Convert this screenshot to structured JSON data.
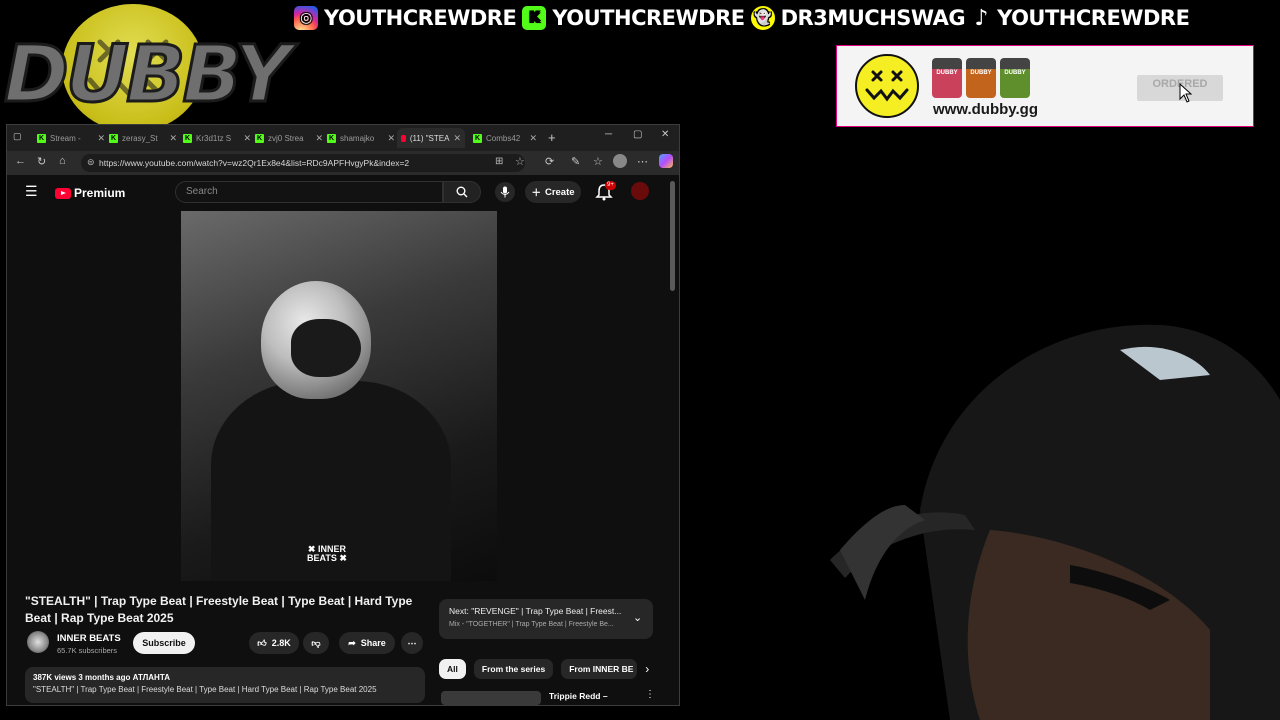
{
  "overlay": {
    "socials": [
      {
        "icon": "instagram-icon",
        "handle": "YOUTHCREWDRE"
      },
      {
        "icon": "kick-icon",
        "handle": "YOUTHCREWDRE"
      },
      {
        "icon": "snapchat-icon",
        "handle": "DR3MUCHSWAG"
      },
      {
        "icon": "tiktok-icon",
        "handle": "YOUTHCREWDRE"
      }
    ],
    "logo_text": "DUBBY",
    "ad": {
      "url": "www.dubby.gg",
      "tub_labels": [
        "DUBBY",
        "DUBBY",
        "DUBBY"
      ],
      "button_label": "ORDERED"
    }
  },
  "browser": {
    "tabs": [
      {
        "label": "Stream - ",
        "icon": "kick-icon"
      },
      {
        "label": "zerasy_St",
        "icon": "kick-icon"
      },
      {
        "label": "Kr3d1tz S",
        "icon": "kick-icon"
      },
      {
        "label": "zvj0 Strea",
        "icon": "kick-icon"
      },
      {
        "label": "shamajko",
        "icon": "kick-icon"
      },
      {
        "label": "(11) \"STEA",
        "icon": "youtube-icon"
      },
      {
        "label": "Combs42",
        "icon": "kick-icon"
      }
    ],
    "url": "https://www.youtube.com/watch?v=wz2Qr1Ex8e4&list=RDc9APFHvgyPk&index=2"
  },
  "youtube": {
    "brand": "Premium",
    "search_placeholder": "Search",
    "create_label": "Create",
    "notification_badge": "9+",
    "video_watermark_line1": "✖ INNER",
    "video_watermark_line2": "BEATS ✖",
    "video_title": "\"STEALTH\" | Trap Type Beat | Freestyle Beat | Type Beat | Hard Type Beat | Rap Type Beat 2025",
    "channel_name": "INNER BEATS",
    "channel_subs": "65.7K subscribers",
    "subscribe_label": "Subscribe",
    "likes": "2.8K",
    "share_label": "Share",
    "next_line1": "Next: \"REVENGE\" | Trap Type Beat | Freest...",
    "next_line2": "Mix - \"TOGETHER\" | Trap Type Beat | Freestyle Be...",
    "chips": [
      "All",
      "From the series",
      "From INNER BE"
    ],
    "description_meta": "387K views  3 months ago  АТЛАНТА",
    "description_text": "\"STEALTH\" | Trap Type Beat | Freestyle Beat | Type Beat | Hard Type Beat | Rap Type Beat 2025",
    "recommended_title": "Trippie Redd –"
  },
  "colors": {
    "kick_green": "#53fc18",
    "youtube_red": "#ff0033",
    "ad_border": "#e4007a",
    "dubby_yellow": "#f4ee22"
  }
}
